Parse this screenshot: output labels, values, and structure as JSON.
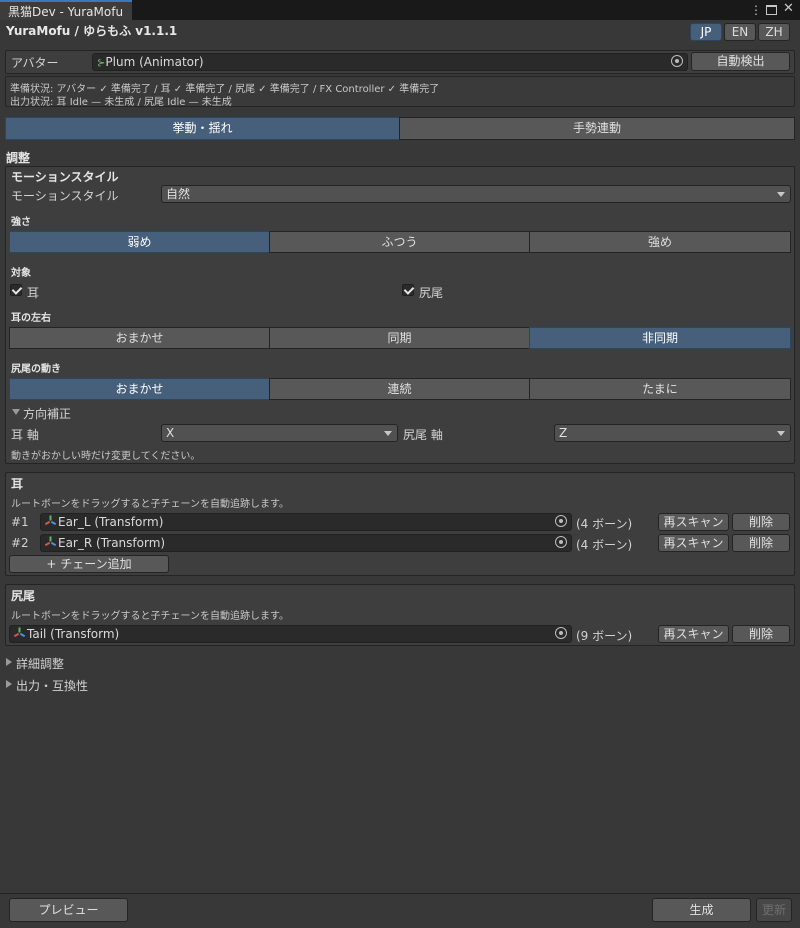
{
  "window": {
    "tab_title": "黒猫Dev - YuraMofu",
    "icons": [
      "more-vertical-icon",
      "maximize-icon",
      "close-icon"
    ]
  },
  "header": {
    "title": "YuraMofu / ゆらもふ v1.1.1",
    "languages": [
      "JP",
      "EN",
      "ZH"
    ],
    "active_language": "JP"
  },
  "avatar": {
    "label": "アバター",
    "value": "Plum (Animator)",
    "auto_detect": "自動検出"
  },
  "status": {
    "prepare": "準備状況: アバター ✓ 準備完了 / 耳 ✓ 準備完了 / 尻尾 ✓ 準備完了 / FX Controller ✓ 準備完了",
    "output": "出力状況: 耳 Idle — 未生成 / 尻尾 Idle — 未生成"
  },
  "main_tabs": [
    {
      "label": "挙動・揺れ",
      "active": true
    },
    {
      "label": "手勢連動",
      "active": false
    }
  ],
  "adjust": {
    "title": "調整",
    "motion_style_title": "モーションスタイル",
    "motion_style_label": "モーションスタイル",
    "motion_style_value": "自然",
    "strength_title": "強さ",
    "strength_options": [
      "弱め",
      "ふつう",
      "強め"
    ],
    "strength_selected": 0,
    "target_title": "対象",
    "target_ear": "耳",
    "target_tail": "尻尾",
    "ear_lr_title": "耳の左右",
    "ear_lr_options": [
      "おまかせ",
      "同期",
      "非同期"
    ],
    "ear_lr_selected": 2,
    "tail_move_title": "尻尾の動き",
    "tail_move_options": [
      "おまかせ",
      "連続",
      "たまに"
    ],
    "tail_move_selected": 0,
    "direction_title": "方向補正",
    "ear_axis_label": "耳 軸",
    "ear_axis_value": "X",
    "tail_axis_label": "尻尾 軸",
    "tail_axis_value": "Z",
    "direction_hint": "動きがおかしい時だけ変更してください。"
  },
  "ears": {
    "title": "耳",
    "hint": "ルートボーンをドラッグすると子チェーンを自動追跡します。",
    "chains": [
      {
        "index": "#1",
        "value": "Ear_L (Transform)",
        "bones": "(4 ボーン)"
      },
      {
        "index": "#2",
        "value": "Ear_R (Transform)",
        "bones": "(4 ボーン)"
      }
    ],
    "rescan": "再スキャン",
    "delete": "削除",
    "add_chain": "+ チェーン追加"
  },
  "tail": {
    "title": "尻尾",
    "hint": "ルートボーンをドラッグすると子チェーンを自動追跡します。",
    "value": "Tail (Transform)",
    "bones": "(9 ボーン)",
    "rescan": "再スキャン",
    "delete": "削除"
  },
  "foldouts": {
    "detail": "詳細調整",
    "output": "出力・互換性"
  },
  "footer": {
    "preview": "プレビュー",
    "generate": "生成",
    "update": "更新"
  },
  "colors": {
    "accent": "#46607c",
    "background": "#383838",
    "panel": "#3e3e3e",
    "field": "#2a2a2a"
  }
}
